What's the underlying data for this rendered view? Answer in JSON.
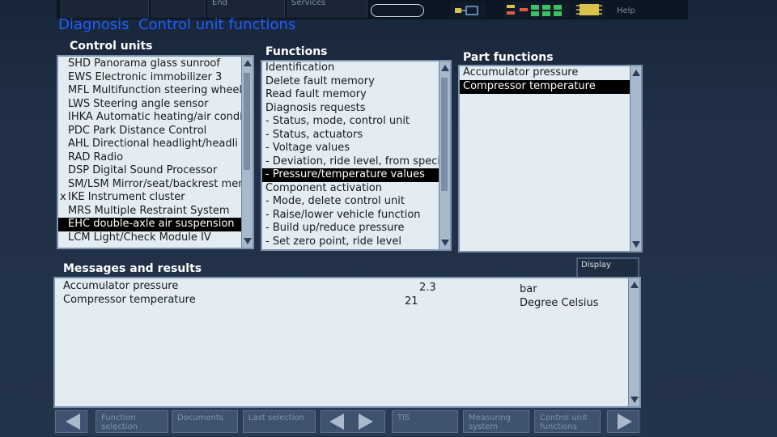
{
  "top": {
    "btn1": "",
    "btn2": "End",
    "btn3": "Services",
    "help": "Help"
  },
  "header": {
    "title": "Diagnosis",
    "subtitle": "Control unit functions"
  },
  "control_units": {
    "label": "Control units",
    "items": [
      {
        "label": "SHD Panorama glass sunroof",
        "mark": ""
      },
      {
        "label": "EWS Electronic immobilizer 3",
        "mark": ""
      },
      {
        "label": "MFL Multifunction steering wheel",
        "mark": ""
      },
      {
        "label": "LWS Steering angle sensor",
        "mark": ""
      },
      {
        "label": "IHKA Automatic heating/air condi",
        "mark": ""
      },
      {
        "label": "PDC Park Distance Control",
        "mark": ""
      },
      {
        "label": "AHL Directional headlight/headli",
        "mark": ""
      },
      {
        "label": "RAD Radio",
        "mark": ""
      },
      {
        "label": "DSP Digital Sound Processor",
        "mark": ""
      },
      {
        "label": "SM/LSM Mirror/seat/backrest mem",
        "mark": ""
      },
      {
        "label": "IKE Instrument cluster",
        "mark": "x"
      },
      {
        "label": "MRS Multiple Restraint System",
        "mark": ""
      },
      {
        "label": "EHC double-axle air suspension",
        "mark": "",
        "selected": true
      },
      {
        "label": "LCM Light/Check Module IV",
        "mark": ""
      }
    ]
  },
  "functions": {
    "label": "Functions",
    "items": [
      {
        "label": "Identification"
      },
      {
        "label": "Delete fault memory"
      },
      {
        "label": "Read fault memory"
      },
      {
        "label": "Diagnosis requests"
      },
      {
        "label": "- Status, mode, control unit"
      },
      {
        "label": "- Status, actuators"
      },
      {
        "label": "- Voltage values"
      },
      {
        "label": "- Deviation, ride level, from specifiec"
      },
      {
        "label": "- Pressure/temperature values",
        "selected": true
      },
      {
        "label": "Component activation"
      },
      {
        "label": "- Mode, delete control unit"
      },
      {
        "label": "- Raise/lower vehicle function"
      },
      {
        "label": "- Build up/reduce pressure"
      },
      {
        "label": "- Set zero point, ride level"
      }
    ]
  },
  "part_functions": {
    "label": "Part functions",
    "items": [
      {
        "label": "Accumulator pressure"
      },
      {
        "label": "Compressor temperature",
        "selected": true
      }
    ]
  },
  "messages": {
    "label": "Messages and results",
    "display_button": "Display",
    "rows": [
      {
        "name": "Accumulator pressure",
        "value": "2.3",
        "unit": "bar"
      },
      {
        "name": "Compressor temperature",
        "value": "21",
        "unit": "Degree Celsius"
      }
    ]
  },
  "bottom": {
    "function_selection": "Function selection",
    "documents": "Documents",
    "last_selection": "Last selection",
    "tis": "TIS",
    "measuring_system": "Measuring system",
    "control_unit_functions": "Control unit functions"
  }
}
